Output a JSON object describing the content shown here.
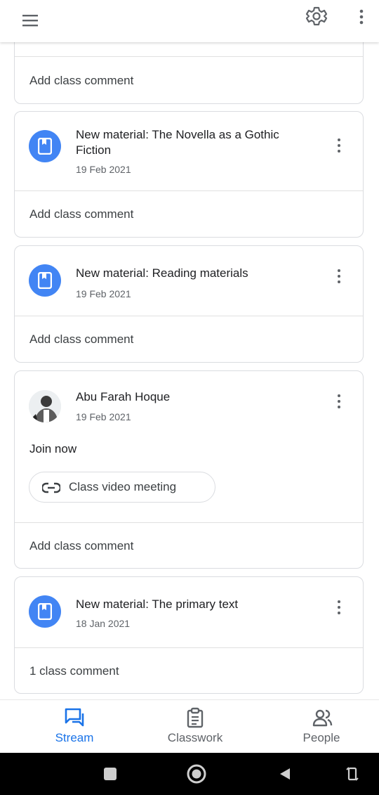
{
  "top_bar": {
    "menu_icon": "hamburger-menu-icon",
    "settings_icon": "gear-icon",
    "more_icon": "more-vert-icon"
  },
  "stream": {
    "first_card_comment": "Add class comment",
    "posts": [
      {
        "type": "material",
        "icon": "material-book-icon",
        "title": "New material: The Novella as a Gothic Fiction",
        "date": "19 Feb 2021",
        "comment": "Add class comment"
      },
      {
        "type": "material",
        "icon": "material-book-icon",
        "title": "New material: Reading materials",
        "date": "19 Feb 2021",
        "comment": "Add class comment"
      },
      {
        "type": "announcement",
        "author": "Abu Farah Hoque",
        "date": "19 Feb 2021",
        "body": "Join now",
        "link_label": "Class video meeting",
        "link_icon": "link-icon",
        "comment": "Add class comment"
      },
      {
        "type": "material",
        "icon": "material-book-icon",
        "title": "New material: The primary text",
        "date": "18 Jan 2021",
        "comment": "1 class comment"
      }
    ]
  },
  "bottom_nav": {
    "items": [
      {
        "label": "Stream",
        "icon": "stream-icon",
        "active": true
      },
      {
        "label": "Classwork",
        "icon": "classwork-icon",
        "active": false
      },
      {
        "label": "People",
        "icon": "people-icon",
        "active": false
      }
    ]
  },
  "colors": {
    "accent": "#1a73e8",
    "material_icon_bg": "#4285f4",
    "card_border": "#dadce0"
  }
}
